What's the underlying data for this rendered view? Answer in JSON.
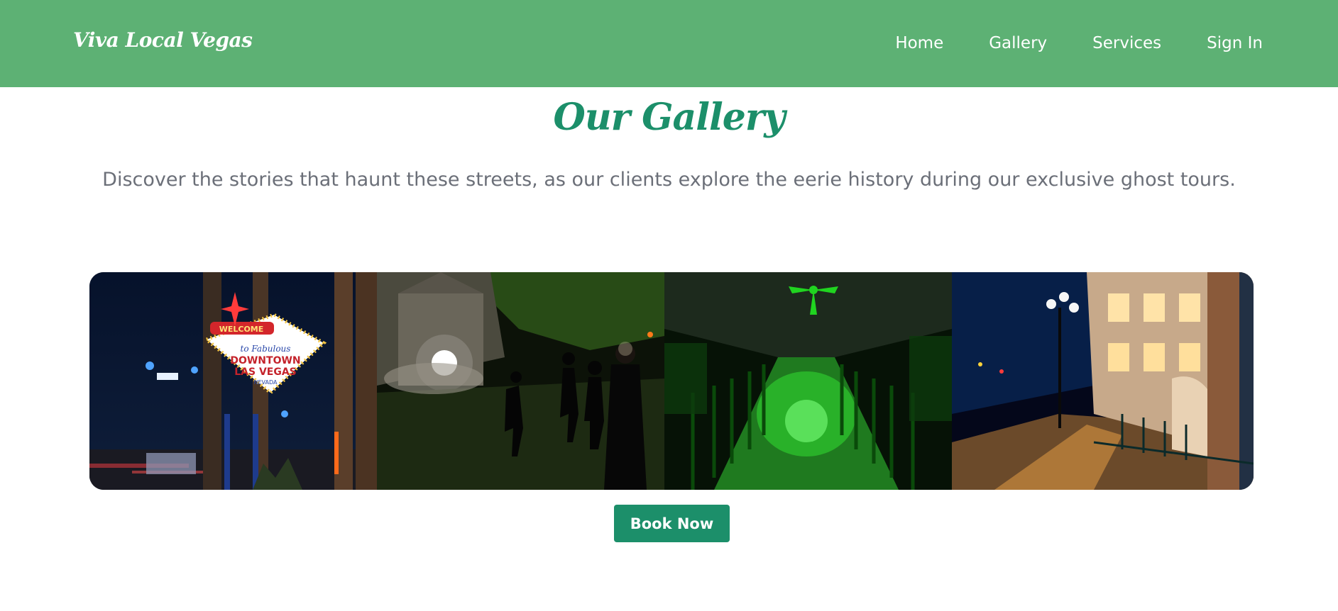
{
  "header": {
    "brand": "Viva Local Vegas",
    "nav": [
      {
        "label": "Home"
      },
      {
        "label": "Gallery"
      },
      {
        "label": "Services"
      },
      {
        "label": "Sign In"
      }
    ]
  },
  "gallery": {
    "title": "Our Gallery",
    "subtitle": "Discover the stories that haunt these streets, as our clients explore the eerie history during our exclusive ghost tours.",
    "sign": {
      "line1": "WELCOME",
      "line2": "to Fabulous",
      "line3": "DOWNTOWN",
      "line4": "LAS VEGAS",
      "line5": "NEVADA"
    }
  },
  "cta": {
    "label": "Book Now"
  },
  "colors": {
    "header_bg": "#5db174",
    "accent": "#1c8f6a"
  }
}
